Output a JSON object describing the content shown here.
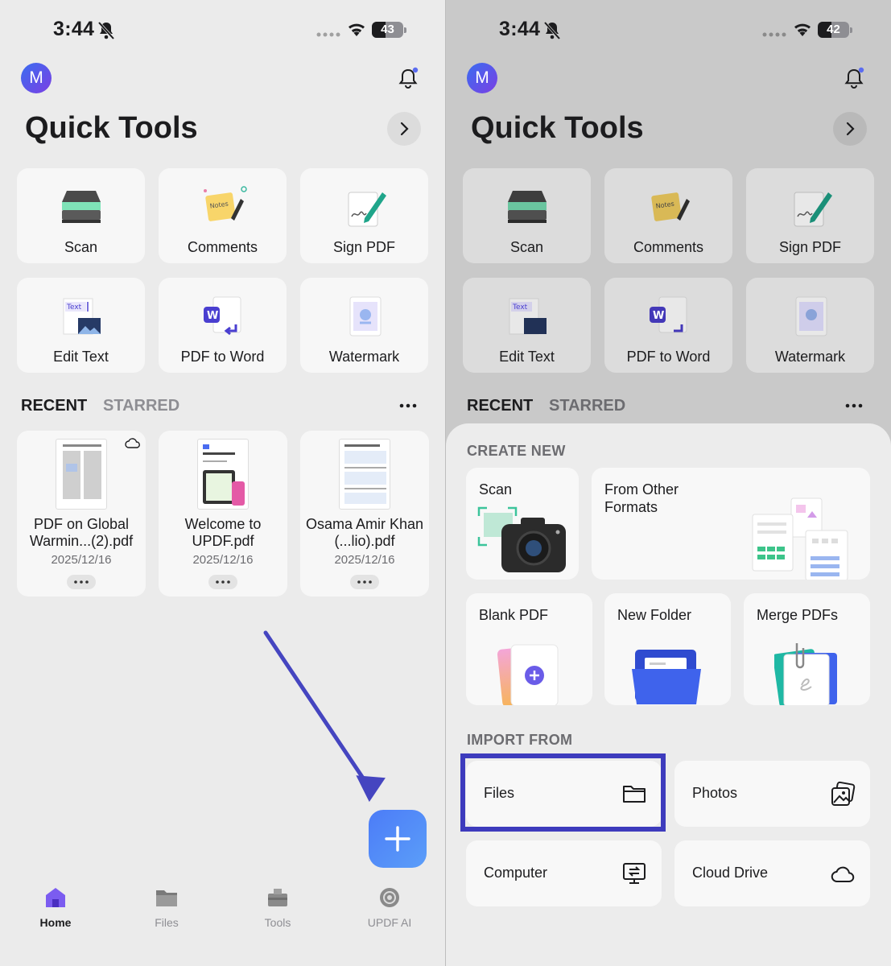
{
  "left": {
    "status": {
      "time": "3:44",
      "battery": "43"
    },
    "avatar_initial": "M",
    "title": "Quick Tools",
    "tools": [
      {
        "label": "Scan",
        "icon": "scanner-icon"
      },
      {
        "label": "Comments",
        "icon": "notes-icon"
      },
      {
        "label": "Sign PDF",
        "icon": "signature-icon"
      },
      {
        "label": "Edit Text",
        "icon": "edit-text-icon"
      },
      {
        "label": "PDF to Word",
        "icon": "pdf-to-word-icon"
      },
      {
        "label": "Watermark",
        "icon": "watermark-icon"
      }
    ],
    "tabs": {
      "recent": "RECENT",
      "starred": "STARRED"
    },
    "recent": [
      {
        "name": "PDF on Global Warmin...(2).pdf",
        "date": "2025/12/16"
      },
      {
        "name": "Welcome to UPDF.pdf",
        "date": "2025/12/16"
      },
      {
        "name": "Osama Amir Khan  (...lio).pdf",
        "date": "2025/12/16"
      }
    ],
    "fab_icon": "plus-icon",
    "tabbar": [
      {
        "label": "Home",
        "icon": "home-icon"
      },
      {
        "label": "Files",
        "icon": "folder-icon"
      },
      {
        "label": "Tools",
        "icon": "toolbox-icon"
      },
      {
        "label": "UPDF AI",
        "icon": "ai-icon"
      }
    ]
  },
  "right": {
    "status": {
      "time": "3:44",
      "battery": "42"
    },
    "avatar_initial": "M",
    "title": "Quick Tools",
    "tools": [
      {
        "label": "Scan"
      },
      {
        "label": "Comments"
      },
      {
        "label": "Sign PDF"
      },
      {
        "label": "Edit Text"
      },
      {
        "label": "PDF to Word"
      },
      {
        "label": "Watermark"
      }
    ],
    "tabs": {
      "recent": "RECENT",
      "starred": "STARRED"
    },
    "create_new_label": "CREATE NEW",
    "create": {
      "scan": "Scan",
      "other_formats": "From Other Formats",
      "blank": "Blank PDF",
      "folder": "New Folder",
      "merge": "Merge PDFs"
    },
    "import_label": "IMPORT FROM",
    "import": {
      "files": "Files",
      "photos": "Photos",
      "computer": "Computer",
      "cloud": "Cloud Drive"
    }
  },
  "colors": {
    "accent": "#4c7cf7",
    "highlight": "#3d3bbd",
    "arrow": "#4545c0"
  }
}
